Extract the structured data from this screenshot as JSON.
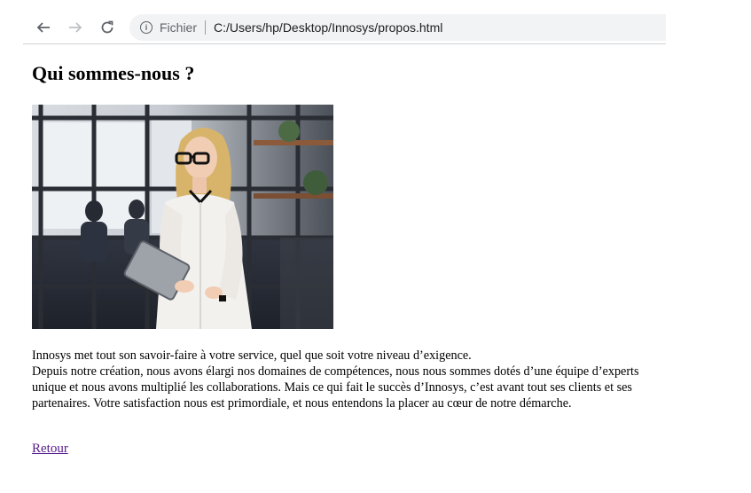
{
  "browser": {
    "back_icon": "arrow-left-icon",
    "forward_icon": "arrow-right-icon",
    "reload_icon": "reload-icon",
    "info_icon": "info-icon",
    "info_glyph": "i",
    "scheme_label": "Fichier",
    "url": "C:/Users/hp/Desktop/Innosys/propos.html"
  },
  "page": {
    "title": "Qui sommes-nous ?",
    "paragraph_1": "Innosys met tout son savoir-faire à votre service, quel que soit votre niveau d’exigence.",
    "paragraph_2": "Depuis notre création, nous avons élargi nos domaines de compétences, nous nous sommes dotés d’une équipe d’experts unique et nous avons multiplié les collaborations. Mais ce qui fait le succès d’Innosys, c’est avant tout ses clients et ses partenaires. Votre satisfaction nous est primordiale, et nous entendons la placer au cœur de notre démarche.",
    "back_link": "Retour"
  },
  "colors": {
    "link_visited": "#551a8b",
    "omnibox_bg": "#f1f3f4"
  }
}
